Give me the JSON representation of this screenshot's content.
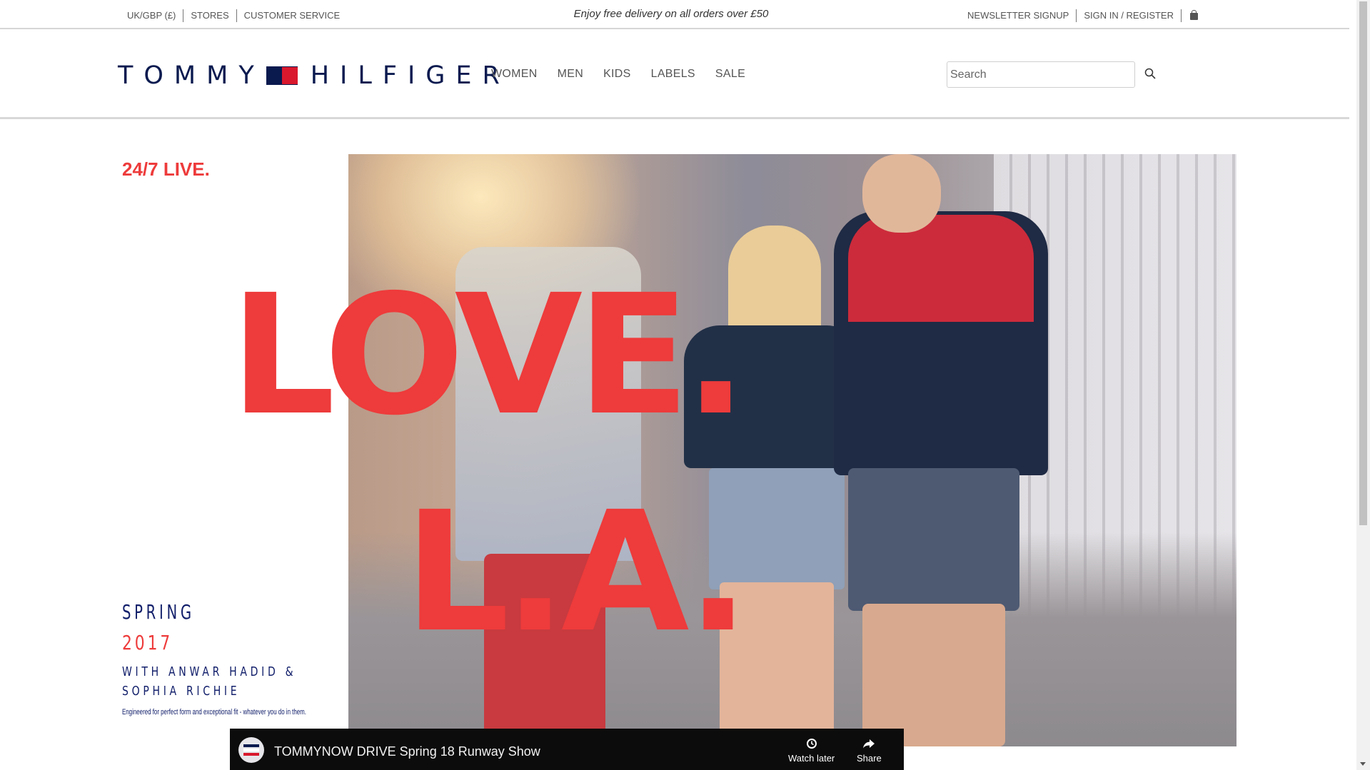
{
  "util": {
    "left_links": [
      "UK/GBP (£)",
      "STORES",
      "CUSTOMER SERVICE"
    ],
    "promo": "Enjoy free delivery on all orders over £50",
    "right_links": [
      "NEWSLETTER SIGNUP",
      "SIGN IN / REGISTER"
    ],
    "bag_icon": "shopping-bag-icon"
  },
  "header": {
    "logo_left": "TOMMY",
    "logo_right": "HILFIGER",
    "flag_colors": [
      "#0a1a4f",
      "#ffffff",
      "#d9182d"
    ],
    "nav": [
      "WOMEN",
      "MEN",
      "KIDS",
      "LABELS",
      "SALE"
    ],
    "search_placeholder": "Search",
    "search_icon": "search-icon"
  },
  "hero": {
    "live_tag": "24/7 LIVE.",
    "headline_1": "LOVE.",
    "headline_2": "L.A.",
    "season": "SPRING",
    "year": "2017",
    "with_line": "WITH ANWAR HADID & SOPHIA RICHIE",
    "tagline": "Engineered for perfect form and exceptional fit - whatever you do in them.",
    "accent_color": "#ee3b3b",
    "navy_color": "#13206b"
  },
  "video": {
    "title": "TOMMYNOW DRIVE Spring 18 Runway Show",
    "watch_later": "Watch later",
    "share": "Share",
    "watch_later_icon": "clock-icon",
    "share_icon": "share-arrow-icon"
  }
}
